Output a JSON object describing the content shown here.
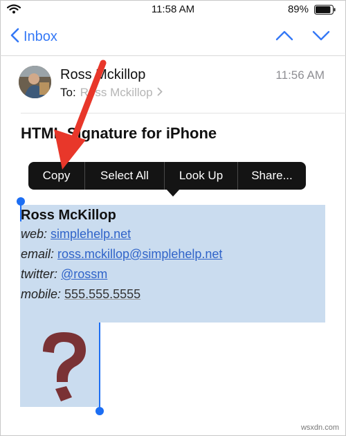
{
  "status_bar": {
    "time": "11:58 AM",
    "battery_percent": "89%",
    "battery_level": 0.89,
    "icons": [
      "wifi-icon",
      "battery-icon"
    ]
  },
  "nav": {
    "back_label": "Inbox",
    "icons": [
      "chevron-left-icon",
      "chevron-up-icon",
      "chevron-down-icon"
    ],
    "accent_color": "#3478f6"
  },
  "message": {
    "sender": "Ross Mckillop",
    "to_label": "To:",
    "to_name": "Ross Mckillop",
    "time": "11:56 AM",
    "subject": "HTML Signature for iPhone"
  },
  "callout_menu": {
    "items": [
      "Copy",
      "Select All",
      "Look Up",
      "Share..."
    ]
  },
  "signature": {
    "name": "Ross McKillop",
    "lines": [
      {
        "label": "web:",
        "value": "simplehelp.net"
      },
      {
        "label": "email:",
        "value": "ross.mckillop@simplehelp.net"
      },
      {
        "label": "twitter:",
        "value": "@rossm"
      },
      {
        "label": "mobile:",
        "value": "555.555.5555"
      }
    ],
    "logo": "question-mark-logo",
    "selection_color": "#cadcef",
    "link_color": "#2f63c9"
  },
  "annotation": {
    "color": "#e8372a",
    "points_to": "Copy"
  },
  "watermark": "wsxdn.com"
}
